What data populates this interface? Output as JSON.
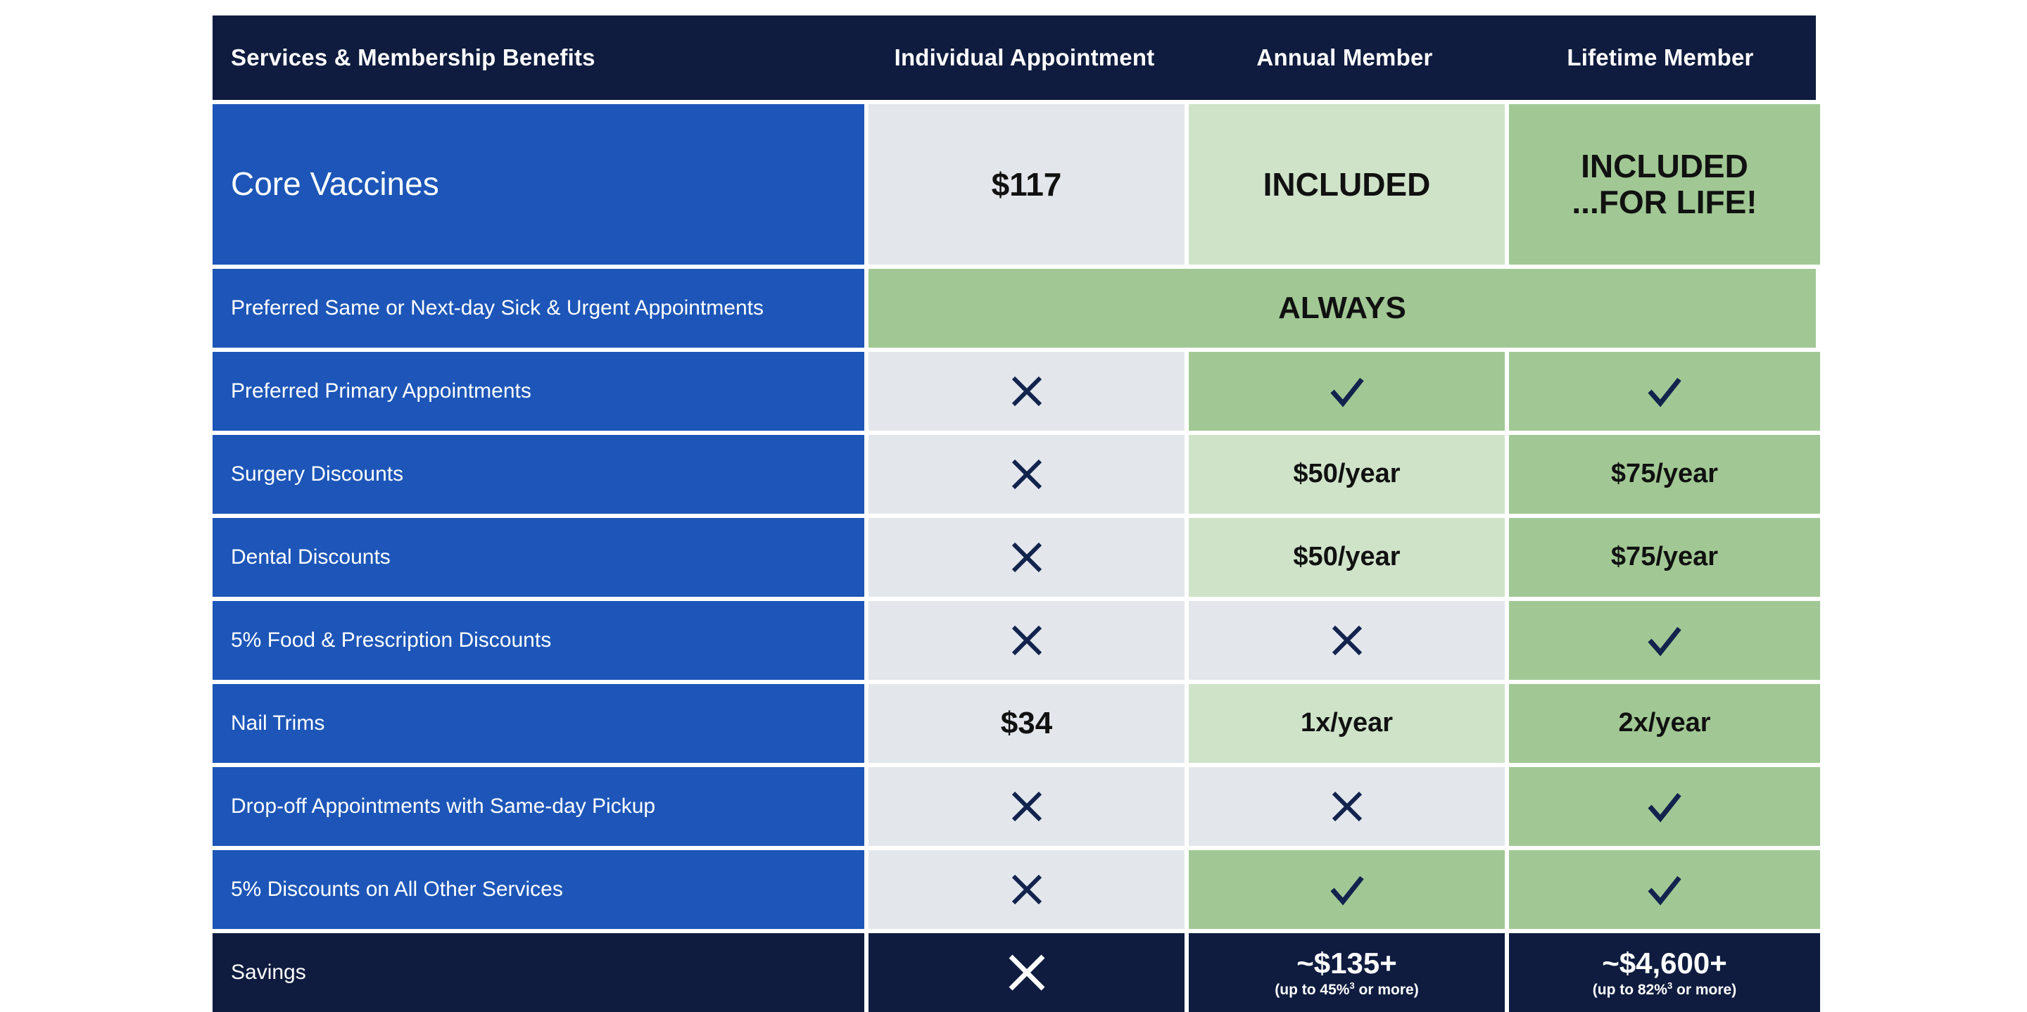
{
  "table": {
    "columns": [
      {
        "key": "service",
        "label": "Services & Membership Benefits"
      },
      {
        "key": "individual",
        "label": "Individual Appointment"
      },
      {
        "key": "annual",
        "label": "Annual Member"
      },
      {
        "key": "lifetime",
        "label": "Lifetime Member"
      }
    ],
    "rows": [
      {
        "label": "Core Vaccines",
        "individual": "$117",
        "annual": "INCLUDED",
        "lifetime_line1": "INCLUDED",
        "lifetime_line2": "...FOR LIFE!"
      },
      {
        "label": "Preferred Same or Next-day Sick & Urgent Appointments",
        "span_value": "ALWAYS"
      },
      {
        "label": "Preferred Primary Appointments",
        "individual": "cross-icon",
        "annual": "check-icon",
        "lifetime": "check-icon"
      },
      {
        "label": "Surgery Discounts",
        "individual": "cross-icon",
        "annual": "$50/year",
        "lifetime": "$75/year"
      },
      {
        "label": "Dental Discounts",
        "individual": "cross-icon",
        "annual": "$50/year",
        "lifetime": "$75/year"
      },
      {
        "label": "5% Food & Prescription Discounts",
        "individual": "cross-icon",
        "annual": "cross-icon",
        "lifetime": "check-icon"
      },
      {
        "label": "Nail Trims",
        "individual": "$34",
        "annual": "1x/year",
        "lifetime": "2x/year"
      },
      {
        "label": "Drop-off Appointments with Same-day Pickup",
        "individual": "cross-icon",
        "annual": "cross-icon",
        "lifetime": "check-icon"
      },
      {
        "label": "5% Discounts on All Other Services",
        "individual": "cross-icon",
        "annual": "check-icon",
        "lifetime": "check-icon"
      },
      {
        "label": "Savings",
        "individual": "cross-icon",
        "annual_amount": "~$135+",
        "annual_note_pre": "(up to 45%",
        "annual_note_sup": "3",
        "annual_note_post": " or more)",
        "lifetime_amount": "~$4,600+",
        "lifetime_note_pre": "(up to 82%",
        "lifetime_note_sup": "3",
        "lifetime_note_post": " or more)"
      }
    ]
  },
  "colors": {
    "header_navy": "#0f1c3f",
    "label_blue": "#1d56b8",
    "cell_grey": "#e3e7ec",
    "green_light": "#cfe3c9",
    "green_mid": "#a1c894",
    "icon_navy": "#12234d",
    "white": "#ffffff"
  }
}
